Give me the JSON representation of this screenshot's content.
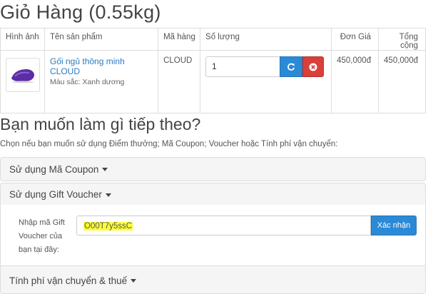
{
  "cart": {
    "title": "Giỏ Hàng  (0.55kg)",
    "columns": {
      "image": "Hình ảnh",
      "name": "Tên sản phẩm",
      "code": "Mã hàng",
      "quantity": "Số lượng",
      "unit_price": "Đơn Giá",
      "total": "Tổng cộng"
    },
    "items": [
      {
        "name": "Gối ngủ thông minh CLOUD",
        "attribute": "Màu sắc: Xanh dương",
        "code": "CLOUD",
        "quantity": "1",
        "unit_price": "450,000đ",
        "total": "450,000đ",
        "thumb_color": "#5b2ea6"
      }
    ],
    "icons": {
      "refresh": "refresh-icon",
      "remove": "remove-circle-icon"
    }
  },
  "next": {
    "heading": "Bạn muốn làm gì tiếp theo?",
    "subtext": "Chọn nếu bạn muốn sử dụng Điểm thưởng; Mã Coupon; Voucher hoặc Tính phí vận chuyển:"
  },
  "panels": {
    "coupon": "Sử dụng Mã Coupon",
    "voucher": "Sử dụng Gift Voucher",
    "shipping": "Tính phí vận chuyển & thuế"
  },
  "voucher_form": {
    "label": "Nhập mã Gift Voucher của bạn tại đây:",
    "value": "O00T7y5ssC",
    "submit": "Xác nhận"
  },
  "colors": {
    "link": "#2a7bc1",
    "primary": "#2b8ad6",
    "danger": "#d9403a",
    "highlight": "#ffff3b"
  }
}
